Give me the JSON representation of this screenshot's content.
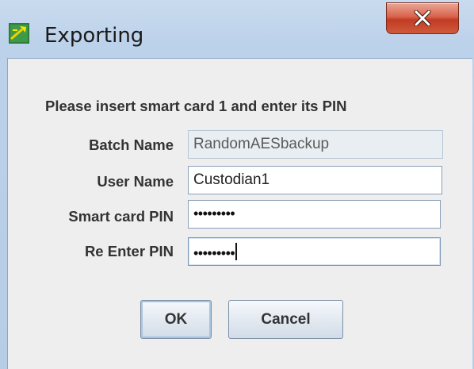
{
  "window": {
    "title": "Exporting",
    "app_icon": "wand-icon",
    "close_icon": "close-icon"
  },
  "prompt": "Please insert smart card 1 and enter its PIN",
  "fields": {
    "batch_name": {
      "label": "Batch Name",
      "value": "RandomAESbackup"
    },
    "user_name": {
      "label": "User Name",
      "value": "Custodian1"
    },
    "smart_card_pin": {
      "label": "Smart card PIN",
      "value": "•••••••••"
    },
    "re_enter_pin": {
      "label": "Re Enter PIN",
      "value": "•••••••••"
    }
  },
  "buttons": {
    "ok": "OK",
    "cancel": "Cancel"
  },
  "colors": {
    "title_bar": "#bcd1ea",
    "close_button": "#c13b24",
    "dialog_background": "#eeeeee"
  }
}
